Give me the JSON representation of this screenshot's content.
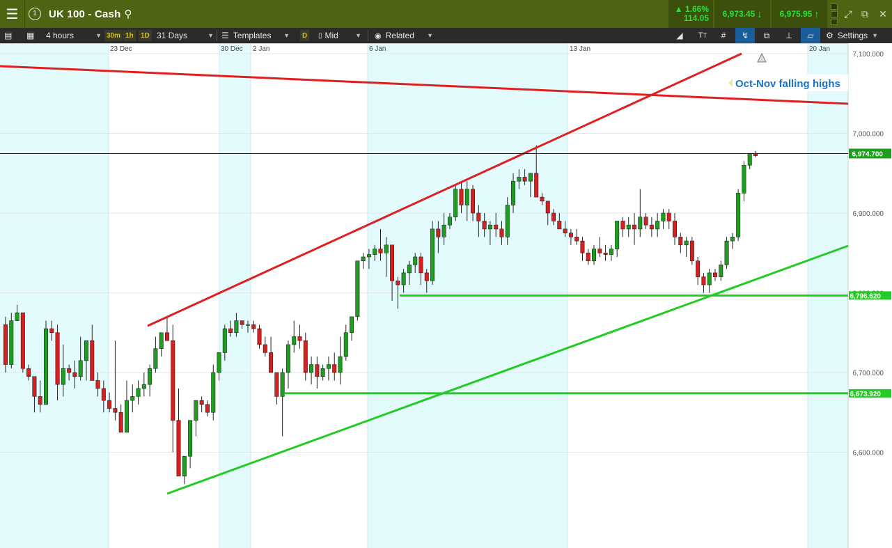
{
  "topbar": {
    "menu_icon": "hamburger-menu-icon",
    "circle_label": "1",
    "title": "UK 100 - Cash",
    "change_pct": "▲ 1.66%",
    "change_abs": "114.05",
    "sell_price": "6,973.45",
    "buy_price": "6,975.95",
    "down_arrow": "↓",
    "up_arrow": "↑",
    "icons": [
      "search-icon",
      "depth-icon",
      "collapse-icon",
      "popout-icon",
      "close-icon"
    ]
  },
  "toolbar": {
    "interval": "4 hours",
    "tf_30m": "30m",
    "tf_1h": "1h",
    "tf_1d": "1D",
    "period": "31 Days",
    "templates": "Templates",
    "d_label": "D",
    "price_type": "Mid",
    "related": "Related",
    "settings": "Settings"
  },
  "chart_data": {
    "type": "candlestick",
    "title": "UK 100 - Cash",
    "x_tick_labels": [
      "23 Dec",
      "30 Dec",
      "2 Jan",
      "6 Jan",
      "13 Jan",
      "20 Jan"
    ],
    "y_tick_labels": [
      "7,100.000",
      "7,000.000",
      "6,900.000",
      "6,800.000",
      "6,700.000",
      "6,600.000"
    ],
    "y_ticks": [
      7100,
      7000,
      6900,
      6800,
      6700,
      6600
    ],
    "ylim": [
      6495,
      7110
    ],
    "current_price": 6974.7,
    "current_price_label": "6,974.700",
    "support_levels": [
      {
        "value": 6796.62,
        "label": "6,796.620",
        "color": "#22cc22"
      },
      {
        "value": 6673.92,
        "label": "6,673.920",
        "color": "#22cc22"
      }
    ],
    "annotation": "Oct-Nov falling highs",
    "up_color": "#1e9e1e",
    "down_color": "#d42020",
    "candles": [
      [
        6760,
        6770,
        6700,
        6710
      ],
      [
        6710,
        6775,
        6705,
        6765
      ],
      [
        6765,
        6785,
        6765,
        6775
      ],
      [
        6775,
        6775,
        6700,
        6705
      ],
      [
        6705,
        6710,
        6690,
        6695
      ],
      [
        6695,
        6690,
        6650,
        6670
      ],
      [
        6670,
        6690,
        6650,
        6660
      ],
      [
        6660,
        6765,
        6660,
        6755
      ],
      [
        6755,
        6765,
        6740,
        6750
      ],
      [
        6750,
        6760,
        6665,
        6685
      ],
      [
        6685,
        6735,
        6670,
        6705
      ],
      [
        6705,
        6710,
        6690,
        6700
      ],
      [
        6700,
        6715,
        6680,
        6695
      ],
      [
        6695,
        6745,
        6690,
        6715
      ],
      [
        6715,
        6740,
        6690,
        6740
      ],
      [
        6740,
        6760,
        6700,
        6690
      ],
      [
        6690,
        6700,
        6670,
        6680
      ],
      [
        6680,
        6690,
        6650,
        6665
      ],
      [
        6665,
        6675,
        6650,
        6655
      ],
      [
        6655,
        6740,
        6640,
        6650
      ],
      [
        6650,
        6660,
        6640,
        6625
      ],
      [
        6625,
        6690,
        6625,
        6665
      ],
      [
        6665,
        6685,
        6650,
        6670
      ],
      [
        6670,
        6690,
        6660,
        6680
      ],
      [
        6680,
        6700,
        6670,
        6685
      ],
      [
        6685,
        6710,
        6670,
        6705
      ],
      [
        6705,
        6745,
        6700,
        6730
      ],
      [
        6730,
        6750,
        6720,
        6750
      ],
      [
        6750,
        6770,
        6745,
        6740
      ],
      [
        6740,
        6760,
        6600,
        6640
      ],
      [
        6640,
        6680,
        6580,
        6570
      ],
      [
        6570,
        6590,
        6560,
        6595
      ],
      [
        6595,
        6640,
        6580,
        6640
      ],
      [
        6640,
        6665,
        6620,
        6665
      ],
      [
        6665,
        6670,
        6650,
        6660
      ],
      [
        6660,
        6665,
        6645,
        6650
      ],
      [
        6650,
        6710,
        6640,
        6700
      ],
      [
        6700,
        6725,
        6690,
        6725
      ],
      [
        6725,
        6760,
        6715,
        6755
      ],
      [
        6755,
        6765,
        6745,
        6750
      ],
      [
        6750,
        6775,
        6745,
        6765
      ],
      [
        6765,
        6765,
        6755,
        6760
      ],
      [
        6760,
        6765,
        6750,
        6760
      ],
      [
        6760,
        6765,
        6750,
        6755
      ],
      [
        6755,
        6760,
        6730,
        6735
      ],
      [
        6735,
        6745,
        6720,
        6725
      ],
      [
        6725,
        6745,
        6700,
        6700
      ],
      [
        6700,
        6700,
        6660,
        6670
      ],
      [
        6670,
        6705,
        6620,
        6700
      ],
      [
        6700,
        6740,
        6680,
        6735
      ],
      [
        6735,
        6765,
        6725,
        6745
      ],
      [
        6745,
        6760,
        6730,
        6740
      ],
      [
        6740,
        6750,
        6690,
        6700
      ],
      [
        6700,
        6720,
        6685,
        6710
      ],
      [
        6710,
        6720,
        6680,
        6695
      ],
      [
        6695,
        6710,
        6690,
        6705
      ],
      [
        6705,
        6720,
        6690,
        6710
      ],
      [
        6710,
        6725,
        6690,
        6700
      ],
      [
        6700,
        6745,
        6685,
        6720
      ],
      [
        6720,
        6760,
        6715,
        6750
      ],
      [
        6750,
        6770,
        6740,
        6770
      ],
      [
        6770,
        6830,
        6765,
        6840
      ],
      [
        6840,
        6850,
        6830,
        6845
      ],
      [
        6845,
        6855,
        6830,
        6848
      ],
      [
        6848,
        6860,
        6840,
        6855
      ],
      [
        6855,
        6880,
        6840,
        6850
      ],
      [
        6850,
        6870,
        6820,
        6860
      ],
      [
        6860,
        6860,
        6790,
        6815
      ],
      [
        6815,
        6820,
        6780,
        6810
      ],
      [
        6810,
        6830,
        6800,
        6825
      ],
      [
        6825,
        6840,
        6810,
        6835
      ],
      [
        6835,
        6850,
        6825,
        6845
      ],
      [
        6845,
        6850,
        6810,
        6825
      ],
      [
        6825,
        6830,
        6800,
        6815
      ],
      [
        6815,
        6890,
        6810,
        6880
      ],
      [
        6880,
        6890,
        6850,
        6870
      ],
      [
        6870,
        6900,
        6860,
        6885
      ],
      [
        6885,
        6900,
        6880,
        6895
      ],
      [
        6895,
        6935,
        6890,
        6930
      ],
      [
        6930,
        6940,
        6900,
        6910
      ],
      [
        6910,
        6940,
        6890,
        6930
      ],
      [
        6930,
        6935,
        6890,
        6900
      ],
      [
        6900,
        6910,
        6870,
        6890
      ],
      [
        6890,
        6900,
        6870,
        6880
      ],
      [
        6880,
        6890,
        6860,
        6885
      ],
      [
        6885,
        6900,
        6870,
        6880
      ],
      [
        6880,
        6890,
        6860,
        6870
      ],
      [
        6870,
        6920,
        6860,
        6910
      ],
      [
        6910,
        6950,
        6900,
        6940
      ],
      [
        6940,
        6955,
        6930,
        6945
      ],
      [
        6945,
        6955,
        6935,
        6940
      ],
      [
        6940,
        6950,
        6920,
        6950
      ],
      [
        6950,
        6985,
        6930,
        6920
      ],
      [
        6920,
        6925,
        6910,
        6915
      ],
      [
        6915,
        6915,
        6885,
        6900
      ],
      [
        6900,
        6905,
        6885,
        6890
      ],
      [
        6890,
        6900,
        6880,
        6880
      ],
      [
        6880,
        6890,
        6870,
        6875
      ],
      [
        6875,
        6880,
        6860,
        6870
      ],
      [
        6870,
        6880,
        6860,
        6865
      ],
      [
        6865,
        6870,
        6840,
        6850
      ],
      [
        6850,
        6855,
        6835,
        6840
      ],
      [
        6840,
        6860,
        6835,
        6855
      ],
      [
        6855,
        6870,
        6845,
        6850
      ],
      [
        6850,
        6860,
        6840,
        6848
      ],
      [
        6848,
        6860,
        6840,
        6855
      ],
      [
        6855,
        6890,
        6845,
        6890
      ],
      [
        6890,
        6895,
        6870,
        6880
      ],
      [
        6880,
        6895,
        6870,
        6885
      ],
      [
        6885,
        6900,
        6860,
        6880
      ],
      [
        6880,
        6930,
        6870,
        6895
      ],
      [
        6895,
        6900,
        6880,
        6885
      ],
      [
        6885,
        6895,
        6870,
        6880
      ],
      [
        6880,
        6900,
        6870,
        6890
      ],
      [
        6890,
        6905,
        6880,
        6900
      ],
      [
        6900,
        6905,
        6880,
        6890
      ],
      [
        6890,
        6900,
        6860,
        6870
      ],
      [
        6870,
        6875,
        6850,
        6860
      ],
      [
        6860,
        6870,
        6845,
        6865
      ],
      [
        6865,
        6870,
        6835,
        6840
      ],
      [
        6840,
        6845,
        6810,
        6820
      ],
      [
        6820,
        6825,
        6800,
        6810
      ],
      [
        6810,
        6830,
        6800,
        6825
      ],
      [
        6825,
        6830,
        6815,
        6820
      ],
      [
        6820,
        6840,
        6815,
        6835
      ],
      [
        6835,
        6870,
        6830,
        6865
      ],
      [
        6865,
        6875,
        6855,
        6870
      ],
      [
        6870,
        6930,
        6865,
        6925
      ],
      [
        6925,
        6965,
        6915,
        6960
      ],
      [
        6960,
        6975,
        6955,
        6975
      ],
      [
        6975,
        6978,
        6970,
        6972
      ]
    ],
    "candle_notes": "OHLC values in index points, read from the price axis; order: open, high, low, close"
  }
}
